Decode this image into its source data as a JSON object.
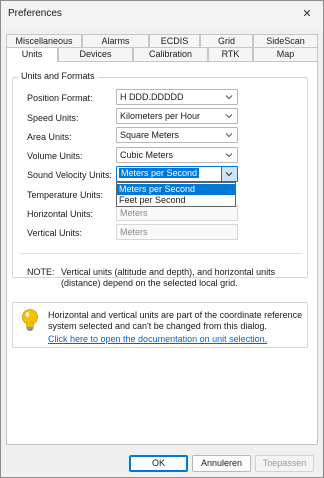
{
  "window": {
    "title": "Preferences",
    "close_icon": "close-icon"
  },
  "tabs": {
    "row1": [
      {
        "label": "Miscellaneous"
      },
      {
        "label": "Alarms"
      },
      {
        "label": "ECDIS"
      },
      {
        "label": "Grid"
      },
      {
        "label": "SideScan"
      }
    ],
    "row2": [
      {
        "label": "Units",
        "active": true
      },
      {
        "label": "Devices"
      },
      {
        "label": "Calibration"
      },
      {
        "label": "RTK"
      },
      {
        "label": "Map"
      }
    ]
  },
  "units_group": {
    "legend": "Units and Formats",
    "rows": [
      {
        "label": "Position Format:",
        "value": "H DDD.DDDDD",
        "type": "combo"
      },
      {
        "label": "Speed Units:",
        "value": "Kilometers per Hour",
        "type": "combo"
      },
      {
        "label": "Area Units:",
        "value": "Square Meters",
        "type": "combo"
      },
      {
        "label": "Volume Units:",
        "value": "Cubic Meters",
        "type": "combo"
      },
      {
        "label": "Sound Velocity Units:",
        "value": "Meters per Second",
        "type": "combo",
        "focused": true
      },
      {
        "label": "Temperature Units:",
        "value": "",
        "type": "hidden"
      },
      {
        "label": "Horizontal Units:",
        "value": "Meters",
        "type": "disabled"
      },
      {
        "label": "Vertical Units:",
        "value": "Meters",
        "type": "disabled"
      }
    ],
    "dropdown_options": [
      "Meters per Second",
      "Feet per Second"
    ],
    "dropdown_selected": "Meters per Second",
    "note_label": "NOTE:",
    "note_text": "Vertical units (altitude and depth), and horizontal units (distance) depend on the selected local grid."
  },
  "info": {
    "icon": "lightbulb-icon",
    "text": "Horizontal and vertical units are part of the coordinate reference system selected and can't be changed from this dialog.",
    "link": "Click here to open the documentation on unit selection."
  },
  "buttons": {
    "ok": "OK",
    "cancel": "Annuleren",
    "apply": "Toepassen"
  },
  "colors": {
    "accent": "#0078d7",
    "link": "#0066cc",
    "bulb": "#f5c200"
  }
}
